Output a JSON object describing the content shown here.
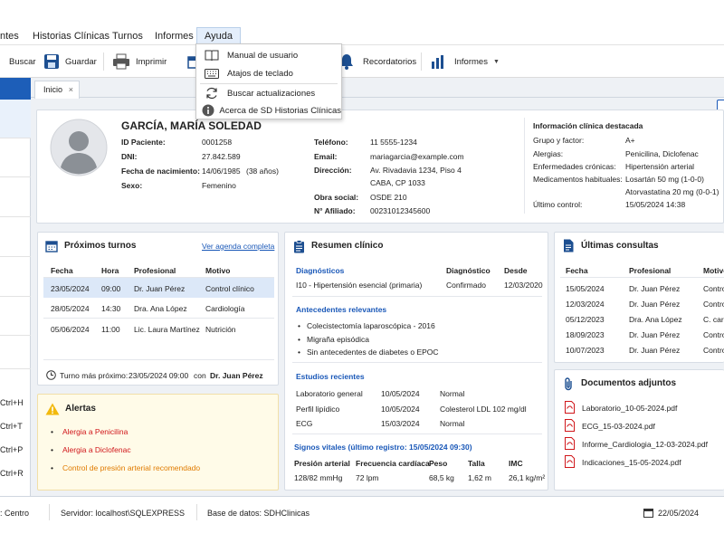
{
  "menu": {
    "items": [
      "ntes",
      "Historias Clínicas",
      "Turnos",
      "Informes",
      "Ayuda"
    ]
  },
  "dropdown": {
    "items": [
      "Manual de usuario",
      "Atajos de teclado",
      "Buscar actualizaciones",
      "Acerca de SD Historias Clínicas"
    ]
  },
  "toolbar": {
    "buscar": "Buscar",
    "guardar": "Guardar",
    "imprimir": "Imprimir",
    "recordatorios": "Recordatorios",
    "informes": "Informes"
  },
  "sidebar": {
    "shortcuts": [
      "Ctrl+H",
      "Ctrl+T",
      "Ctrl+P",
      "Ctrl+R"
    ]
  },
  "tabs": [
    {
      "label": "Inicio",
      "close": "×"
    }
  ],
  "patient": {
    "name": "GARCÍA, MARÍA SOLEDAD",
    "id_label": "ID Paciente:",
    "id": "0001258",
    "dni_label": "DNI:",
    "dni": "27.842.589",
    "dob_label": "Fecha de nacimiento:",
    "dob": "14/06/1985",
    "age": "(38 años)",
    "sex_label": "Sexo:",
    "sex": "Femenino",
    "phone_label": "Teléfono:",
    "phone": "11 5555-1234",
    "email_label": "Email:",
    "email": "mariagarcia@example.com",
    "address_label": "Dirección:",
    "address1": "Av. Rivadavia 1234, Piso 4",
    "address2": "CABA, CP 1033",
    "insurance_label": "Obra social:",
    "insurance": "OSDE 210",
    "member_label": "N° Afiliado:",
    "member": "00231012345600"
  },
  "clinical_info": {
    "title": "Información clínica destacada",
    "blood_label": "Grupo y factor:",
    "blood": "A+",
    "allergies_label": "Alergias:",
    "allergies": "Penicilina, Diclofenac",
    "chronic_label": "Enfermedades crónicas:",
    "chronic": "Hipertensión arterial",
    "meds_label": "Medicamentos habituales:",
    "med1": "Losartán 50 mg (1-0-0)",
    "med2": "Atorvastatina 20 mg (0-0-1)",
    "last_control_label": "Último control:",
    "last_control": "15/05/2024 14:38"
  },
  "turnos": {
    "title": "Próximos turnos",
    "link": "Ver agenda completa",
    "headers": [
      "Fecha",
      "Hora",
      "Profesional",
      "Motivo"
    ],
    "rows": [
      [
        "23/05/2024",
        "09:00",
        "Dr. Juan Pérez",
        "Control clínico"
      ],
      [
        "28/05/2024",
        "14:30",
        "Dra. Ana López",
        "Cardiología"
      ],
      [
        "05/06/2024",
        "11:00",
        "Lic. Laura Martínez",
        "Nutrición"
      ]
    ],
    "next_label": "Turno más próximo:",
    "next_date": "23/05/2024 09:00",
    "next_con": "con",
    "next_doctor": "Dr. Juan Pérez"
  },
  "alertas": {
    "title": "Alertas",
    "items": [
      {
        "text": "Alergia a Penicilina",
        "color": "#d0161a"
      },
      {
        "text": "Alergia a Diclofenac",
        "color": "#d0161a"
      },
      {
        "text": "Control de presión arterial recomendado",
        "color": "#e07b00"
      }
    ]
  },
  "resumen": {
    "title": "Resumen clínico",
    "diag_title": "Diagnósticos",
    "diag_col2": "Diagnóstico",
    "diag_col3": "Desde",
    "diag_row": [
      "I10 - Hipertensión esencial (primaria)",
      "Confirmado",
      "12/03/2020"
    ],
    "antecedentes_title": "Antecedentes relevantes",
    "antecedentes": [
      "Colecistectomía laparoscópica - 2016",
      "Migraña episódica",
      "Sin antecedentes de diabetes o EPOC"
    ],
    "estudios_title": "Estudios recientes",
    "estudios": [
      [
        "Laboratorio general",
        "10/05/2024",
        "Normal"
      ],
      [
        "Perfil lipídico",
        "10/05/2024",
        "Colesterol LDL 102 mg/dl"
      ],
      [
        "ECG",
        "15/03/2024",
        "Normal"
      ]
    ],
    "vitales_title": "Signos vitales (último registro: 15/05/2024 09:30)",
    "vitales_headers": [
      "Presión arterial",
      "Frecuencia cardíaca",
      "Peso",
      "Talla",
      "IMC"
    ],
    "vitales_values": [
      "128/82 mmHg",
      "72 lpm",
      "68,5 kg",
      "1,62 m",
      "26,1 kg/m²"
    ]
  },
  "consultas": {
    "title": "Últimas consultas",
    "headers": [
      "Fecha",
      "Profesional",
      "Motivo"
    ],
    "rows": [
      [
        "15/05/2024",
        "Dr. Juan Pérez",
        "Contro"
      ],
      [
        "12/03/2024",
        "Dr. Juan Pérez",
        "Contro"
      ],
      [
        "05/12/2023",
        "Dra. Ana López",
        "C. card"
      ],
      [
        "18/09/2023",
        "Dr. Juan Pérez",
        "Contro"
      ],
      [
        "10/07/2023",
        "Dr. Juan Pérez",
        "Contro"
      ]
    ]
  },
  "documentos": {
    "title": "Documentos adjuntos",
    "files": [
      "Laboratorio_10-05-2024.pdf",
      "ECG_15-03-2024.pdf",
      "Informe_Cardiologia_12-03-2024.pdf",
      "Indicaciones_15-05-2024.pdf"
    ]
  },
  "status": {
    "location": ": Centro",
    "server": "Servidor: localhost\\SQLEXPRESS",
    "db": "Base de datos: SDHClinicas",
    "date": "22/05/2024"
  },
  "colors": {
    "accent": "#1a58b8",
    "alert_red": "#d0161a",
    "alert_orange": "#e07b00",
    "selected_row": "#dce8f8",
    "alert_bg": "#fffbe8"
  }
}
